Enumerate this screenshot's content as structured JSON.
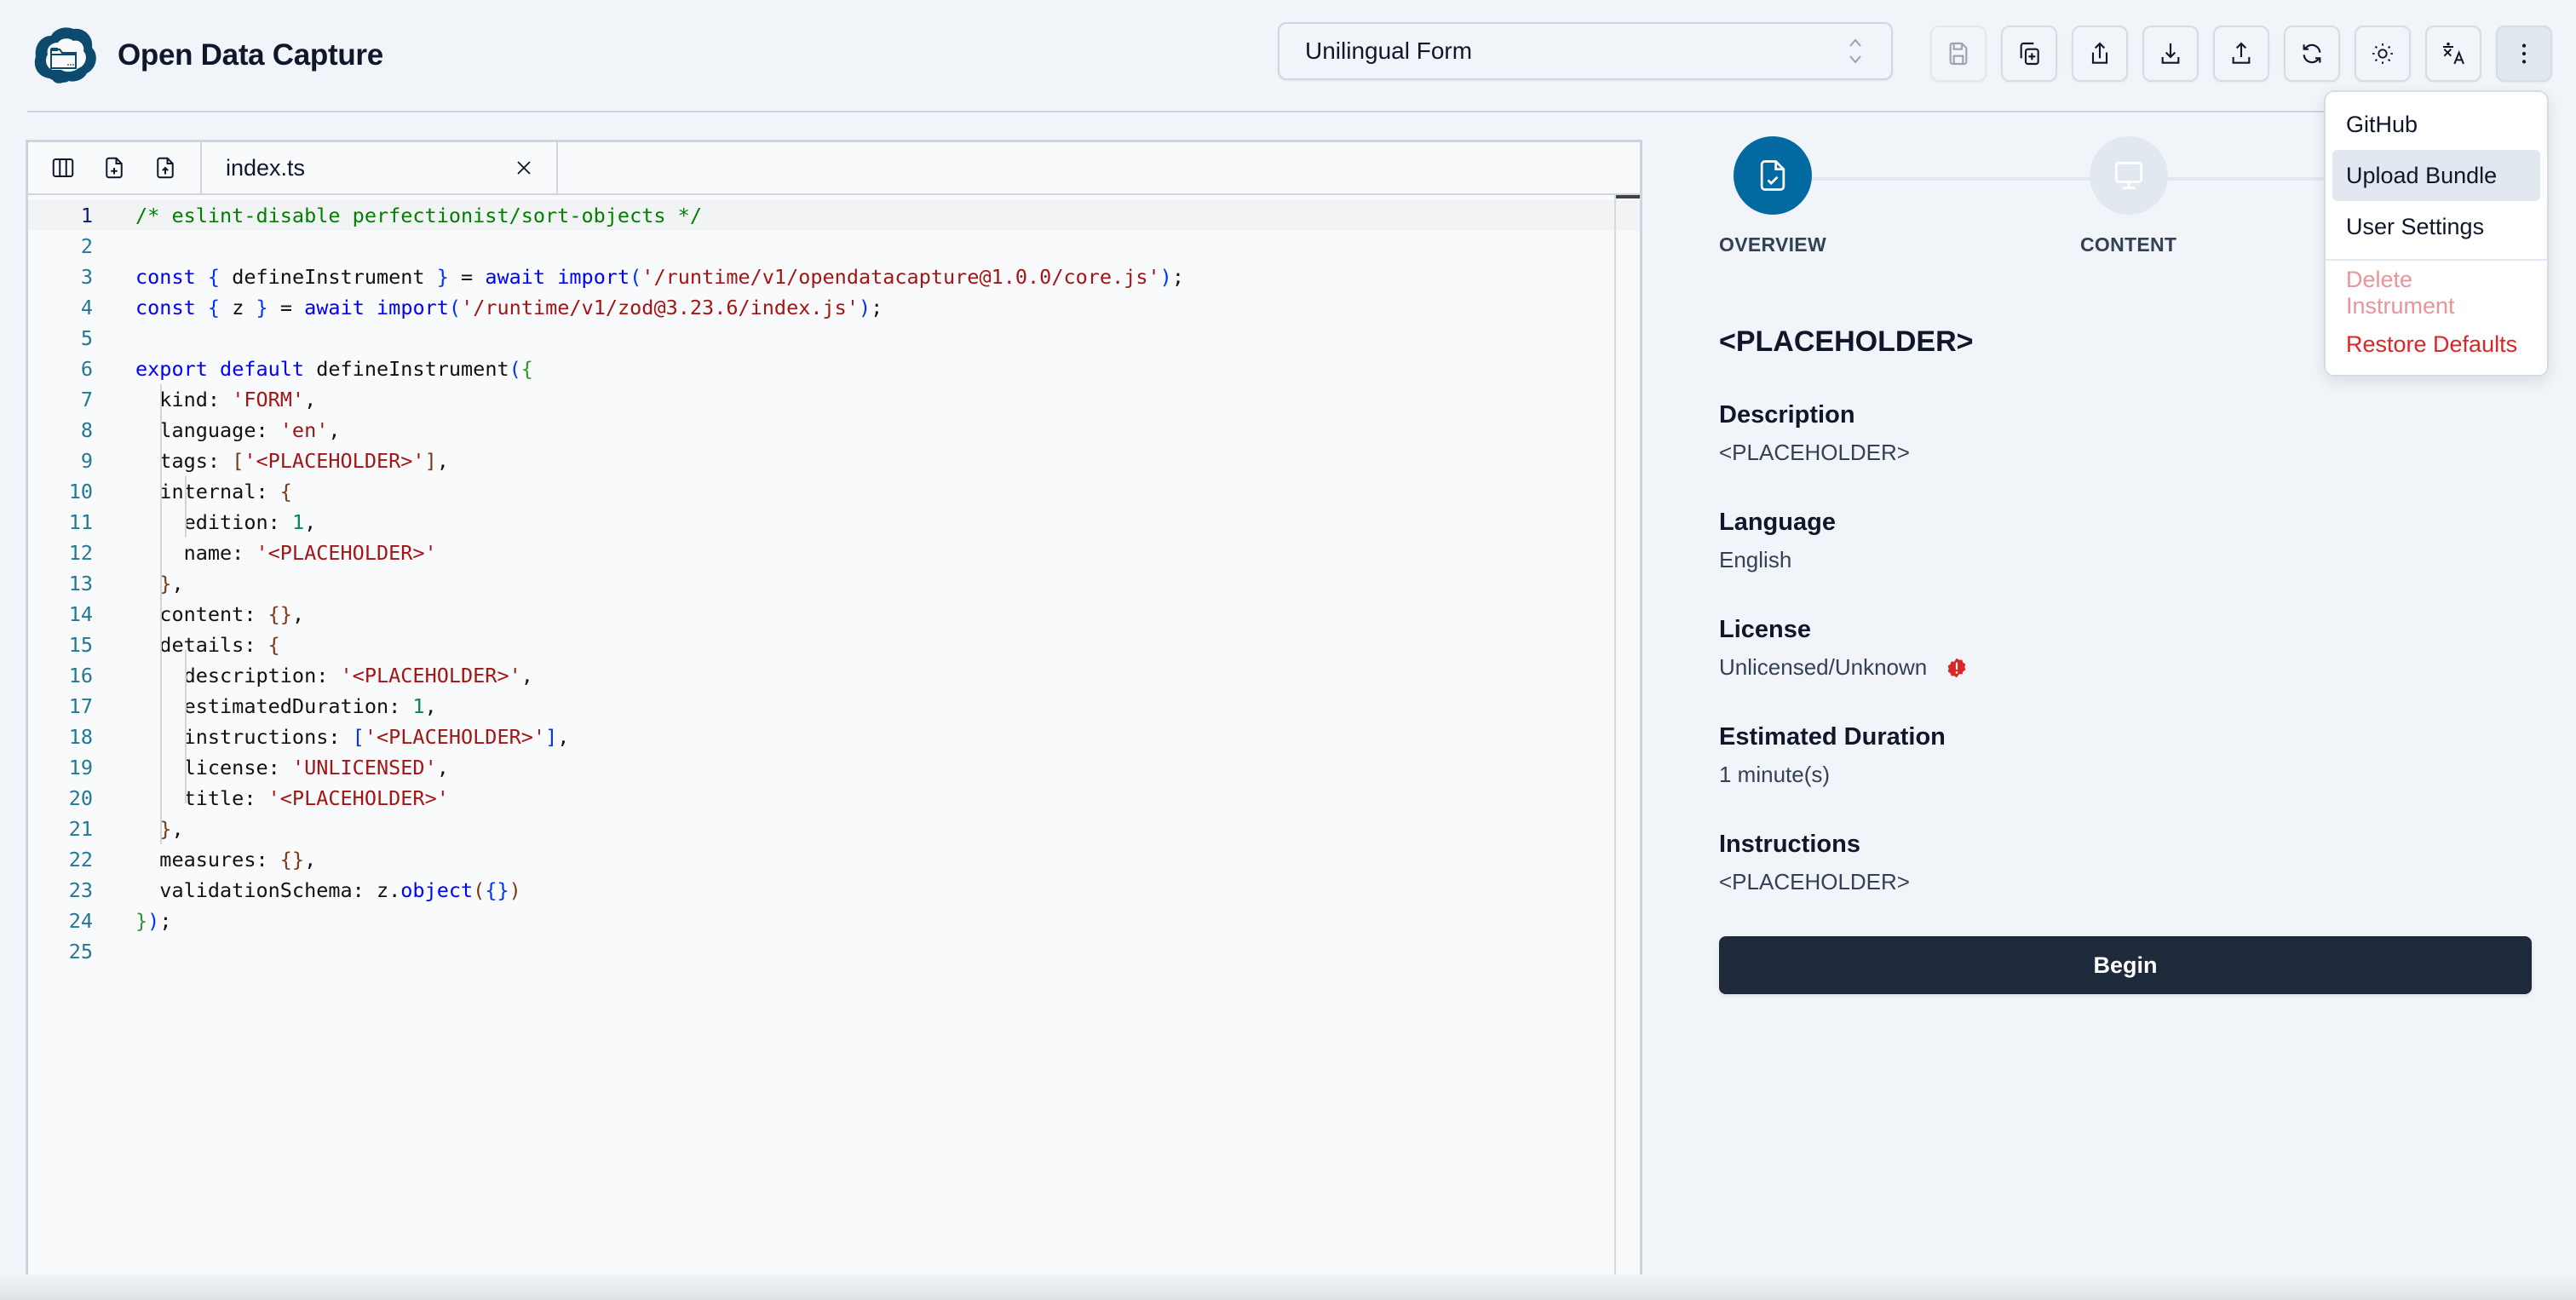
{
  "app": {
    "title": "Open Data Capture",
    "logo_icon": "cloud-folder-logo"
  },
  "header": {
    "instrument_select": {
      "value": "Unilingual Form",
      "icon": "chevron-up-down-icon"
    },
    "toolbar": [
      {
        "name": "save-button",
        "icon": "save-icon",
        "disabled": true
      },
      {
        "name": "copy-button",
        "icon": "copy-plus-icon",
        "disabled": false
      },
      {
        "name": "share-button",
        "icon": "share-icon",
        "disabled": false
      },
      {
        "name": "download-button",
        "icon": "download-icon",
        "disabled": false
      },
      {
        "name": "upload-button",
        "icon": "upload-icon",
        "disabled": false
      },
      {
        "name": "refresh-button",
        "icon": "refresh-icon",
        "disabled": false
      },
      {
        "name": "theme-toggle-button",
        "icon": "sun-icon",
        "disabled": false
      },
      {
        "name": "language-button",
        "icon": "translate-icon",
        "disabled": false
      },
      {
        "name": "more-menu-button",
        "icon": "more-vertical-icon",
        "disabled": false,
        "active": true
      }
    ]
  },
  "menu": {
    "items": [
      {
        "label": "GitHub",
        "style": "normal"
      },
      {
        "label": "Upload Bundle",
        "style": "highlight"
      },
      {
        "label": "User Settings",
        "style": "normal"
      }
    ],
    "danger_items": [
      {
        "label": "Delete Instrument",
        "style": "danger-muted"
      },
      {
        "label": "Restore Defaults",
        "style": "danger"
      }
    ]
  },
  "editor": {
    "actions": [
      {
        "name": "toggle-sidebar-button",
        "icon": "columns-icon"
      },
      {
        "name": "new-file-button",
        "icon": "file-plus-icon"
      },
      {
        "name": "upload-file-button",
        "icon": "file-upload-icon"
      }
    ],
    "tab": {
      "filename": "index.ts",
      "close_icon": "close-icon"
    },
    "current_line": 1,
    "lines": [
      [
        [
          "comment",
          "/* eslint-disable perfectionist/sort-objects */"
        ]
      ],
      [],
      [
        [
          "kw",
          "const"
        ],
        [
          "t",
          " "
        ],
        [
          "b2",
          "{"
        ],
        [
          "t",
          " defineInstrument "
        ],
        [
          "b2",
          "}"
        ],
        [
          "t",
          " = "
        ],
        [
          "kw",
          "await"
        ],
        [
          "t",
          " "
        ],
        [
          "kw",
          "import"
        ],
        [
          "b2",
          "("
        ],
        [
          "str",
          "'/runtime/v1/opendatacapture@1.0.0/core.js'"
        ],
        [
          "b2",
          ")"
        ],
        [
          "t",
          ";"
        ]
      ],
      [
        [
          "kw",
          "const"
        ],
        [
          "t",
          " "
        ],
        [
          "b2",
          "{"
        ],
        [
          "t",
          " z "
        ],
        [
          "b2",
          "}"
        ],
        [
          "t",
          " = "
        ],
        [
          "kw",
          "await"
        ],
        [
          "t",
          " "
        ],
        [
          "kw",
          "import"
        ],
        [
          "b2",
          "("
        ],
        [
          "str",
          "'/runtime/v1/zod@3.23.6/index.js'"
        ],
        [
          "b2",
          ")"
        ],
        [
          "t",
          ";"
        ]
      ],
      [],
      [
        [
          "kw",
          "export"
        ],
        [
          "t",
          " "
        ],
        [
          "kw",
          "default"
        ],
        [
          "t",
          " defineInstrument"
        ],
        [
          "b2",
          "("
        ],
        [
          "b1",
          "{"
        ]
      ],
      [
        [
          "t",
          "  kind: "
        ],
        [
          "str",
          "'FORM'"
        ],
        [
          "t",
          ","
        ]
      ],
      [
        [
          "t",
          "  language: "
        ],
        [
          "str",
          "'en'"
        ],
        [
          "t",
          ","
        ]
      ],
      [
        [
          "t",
          "  tags: "
        ],
        [
          "b3",
          "["
        ],
        [
          "str",
          "'<PLACEHOLDER>'"
        ],
        [
          "b3",
          "]"
        ],
        [
          "t",
          ","
        ]
      ],
      [
        [
          "t",
          "  internal: "
        ],
        [
          "b3",
          "{"
        ]
      ],
      [
        [
          "t",
          "    edition: "
        ],
        [
          "num",
          "1"
        ],
        [
          "t",
          ","
        ]
      ],
      [
        [
          "t",
          "    name: "
        ],
        [
          "str",
          "'<PLACEHOLDER>'"
        ]
      ],
      [
        [
          "t",
          "  "
        ],
        [
          "b3",
          "}"
        ],
        [
          "t",
          ","
        ]
      ],
      [
        [
          "t",
          "  content: "
        ],
        [
          "b3",
          "{}"
        ],
        [
          "t",
          ","
        ]
      ],
      [
        [
          "t",
          "  details: "
        ],
        [
          "b3",
          "{"
        ]
      ],
      [
        [
          "t",
          "    description: "
        ],
        [
          "str",
          "'<PLACEHOLDER>'"
        ],
        [
          "t",
          ","
        ]
      ],
      [
        [
          "t",
          "    estimatedDuration: "
        ],
        [
          "num",
          "1"
        ],
        [
          "t",
          ","
        ]
      ],
      [
        [
          "t",
          "    instructions: "
        ],
        [
          "b2",
          "["
        ],
        [
          "str",
          "'<PLACEHOLDER>'"
        ],
        [
          "b2",
          "]"
        ],
        [
          "t",
          ","
        ]
      ],
      [
        [
          "t",
          "    license: "
        ],
        [
          "str",
          "'UNLICENSED'"
        ],
        [
          "t",
          ","
        ]
      ],
      [
        [
          "t",
          "    title: "
        ],
        [
          "str",
          "'<PLACEHOLDER>'"
        ]
      ],
      [
        [
          "t",
          "  "
        ],
        [
          "b3",
          "}"
        ],
        [
          "t",
          ","
        ]
      ],
      [
        [
          "t",
          "  measures: "
        ],
        [
          "b3",
          "{}"
        ],
        [
          "t",
          ","
        ]
      ],
      [
        [
          "t",
          "  validationSchema: z."
        ],
        [
          "fn",
          "object"
        ],
        [
          "b3",
          "("
        ],
        [
          "b2",
          "{}"
        ],
        [
          "b3",
          ")"
        ]
      ],
      [
        [
          "b1",
          "}"
        ],
        [
          "b2",
          ")"
        ],
        [
          "t",
          ";"
        ]
      ],
      []
    ]
  },
  "preview": {
    "steps": [
      {
        "label": "OVERVIEW",
        "icon": "file-check-icon",
        "active": true
      },
      {
        "label": "CONTENT",
        "icon": "monitor-icon",
        "active": false
      }
    ],
    "title": "<PLACEHOLDER>",
    "fields": [
      {
        "label": "Description",
        "value": "<PLACEHOLDER>"
      },
      {
        "label": "Language",
        "value": "English"
      },
      {
        "label": "License",
        "value": "Unlicensed/Unknown",
        "badge_icon": "alert-badge-icon"
      },
      {
        "label": "Estimated Duration",
        "value": "1 minute(s)"
      },
      {
        "label": "Instructions",
        "value": "<PLACEHOLDER>"
      }
    ],
    "begin_label": "Begin"
  },
  "colors": {
    "accent": "#0369a1",
    "primary_button": "#1e293b",
    "danger": "#dc2626",
    "background": "#f1f5f9"
  }
}
